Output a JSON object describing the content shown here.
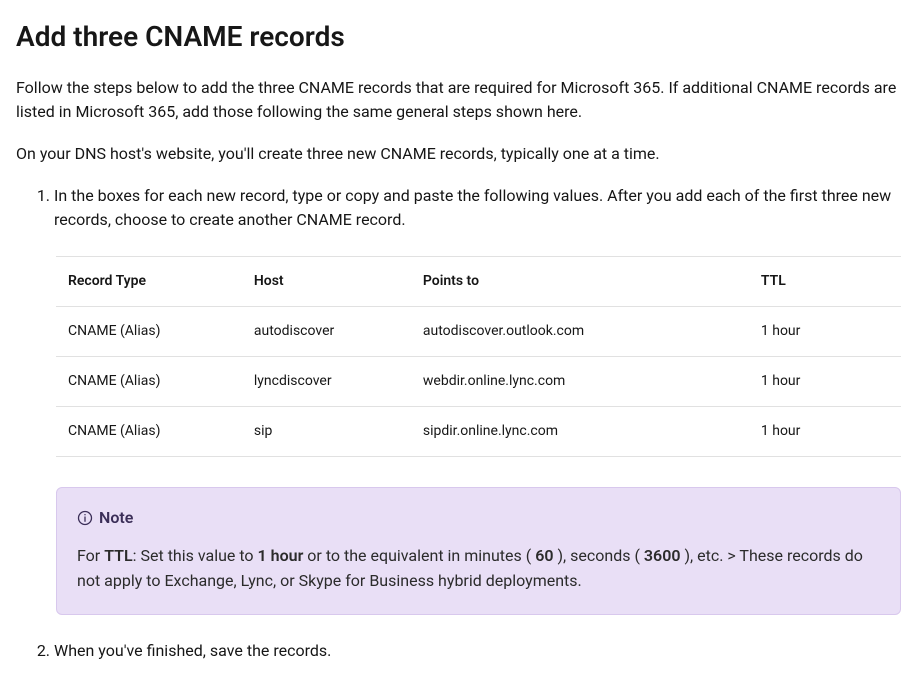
{
  "heading": "Add three CNAME records",
  "intro1": "Follow the steps below to add the three CNAME records that are required for Microsoft 365. If additional CNAME records are listed in Microsoft 365, add those following the same general steps shown here.",
  "intro2": "On your DNS host's website, you'll create three new CNAME records, typically one at a time.",
  "step1": "In the boxes for each new record, type or copy and paste the following values. After you add each of the first three new records, choose to create another CNAME record.",
  "step2": "When you've finished, save the records.",
  "table": {
    "headers": {
      "type": "Record Type",
      "host": "Host",
      "points": "Points to",
      "ttl": "TTL"
    },
    "rows": [
      {
        "type": "CNAME (Alias)",
        "host": "autodiscover",
        "points": "autodiscover.outlook.com",
        "ttl": "1 hour"
      },
      {
        "type": "CNAME (Alias)",
        "host": "lyncdiscover",
        "points": "webdir.online.lync.com",
        "ttl": "1 hour"
      },
      {
        "type": "CNAME (Alias)",
        "host": "sip",
        "points": "sipdir.online.lync.com",
        "ttl": "1 hour"
      }
    ]
  },
  "note": {
    "label": "Note",
    "prefix": "For ",
    "ttl_label": "TTL",
    "mid1": ": Set this value to ",
    "one_hour": "1 hour",
    "mid2": " or to the equivalent in minutes ( ",
    "sixty": "60",
    "mid3": " ), seconds ( ",
    "thirty6": "3600",
    "mid4": " ), etc. > These records do not apply to Exchange, Lync, or Skype for Business hybrid deployments."
  }
}
